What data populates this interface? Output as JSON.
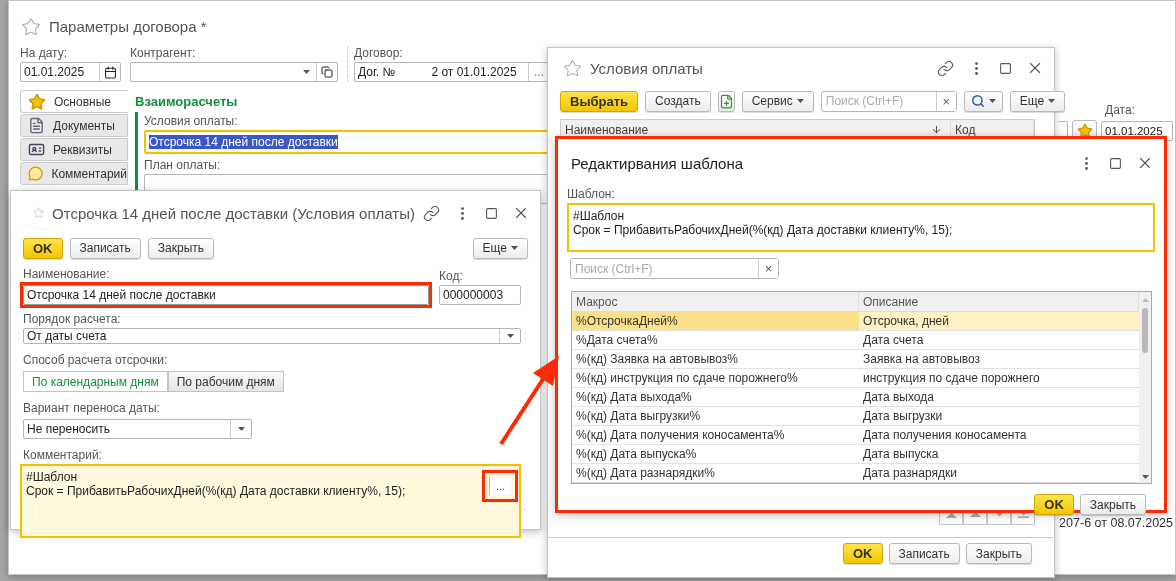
{
  "main_window": {
    "title": "Параметры договора *",
    "date_label": "На дату:",
    "date_value": "01.01.2025",
    "counterparty_label": "Контрагент:",
    "contract_label": "Договор:",
    "contract_value_start": "Дог. №",
    "contract_value_end": "2 от 01.01.2025",
    "contract_select": "...",
    "tabs": [
      {
        "label": "Основные",
        "selected": true,
        "kind": "star"
      },
      {
        "label": "Документы",
        "selected": false,
        "kind": "document"
      },
      {
        "label": "Реквизиты",
        "selected": false,
        "kind": "card"
      },
      {
        "label": "Комментарий",
        "selected": false,
        "kind": "comment"
      }
    ],
    "section_title": "Взаиморасчеты",
    "payment_terms_label": "Условия оплаты:",
    "payment_terms_value": "Отсрочка 14 дней после доставки",
    "payment_terms_text_selected": true,
    "payment_plan_label": "План оплаты:",
    "right_date_label": "Дата:",
    "right_date_value": "01.01.2025",
    "footer_text": "207-6 от 08.07.2025"
  },
  "list_window": {
    "title": "Условия оплаты",
    "select": "Выбрать",
    "create": "Создать",
    "service": "Сервис",
    "search_placeholder": "Поиск (Ctrl+F)",
    "search_clear": "×",
    "more": "Еще",
    "columns": [
      "Наименование",
      "Код"
    ],
    "footer_buttons": [
      {
        "label": "OK",
        "kind": "default"
      },
      {
        "label": "Записать",
        "kind": "plain"
      },
      {
        "label": "Закрыть",
        "kind": "plain"
      }
    ]
  },
  "terms_dialog": {
    "title": "Отсрочка 14 дней после доставки (Условия оплаты)",
    "buttons": [
      {
        "label": "OK",
        "kind": "default"
      },
      {
        "label": "Записать",
        "kind": "plain"
      },
      {
        "label": "Закрыть",
        "kind": "plain"
      }
    ],
    "more": "Еще",
    "name_label": "Наименование:",
    "name_value": "Отсрочка 14 дней после доставки",
    "name_highlighted": true,
    "code_label": "Код:",
    "code_value": "000000003",
    "order_label": "Порядок расчета:",
    "order_value": "От даты счета",
    "method_label": "Способ расчета отсрочки:",
    "method_options": [
      {
        "label": "По календарным дням",
        "selected": true
      },
      {
        "label": "По рабочим дням",
        "selected": false
      }
    ],
    "shift_label": "Вариант переноса даты:",
    "shift_value": "Не переносить",
    "comment_label": "Комментарий:",
    "comment_lines": [
      "#Шаблон",
      "Срок = ПрибавитьРабочихДней(%(кд) Дата доставки клиенту%, 15);"
    ],
    "comment_button": "...",
    "comment_button_highlighted": true
  },
  "template_dialog": {
    "title": "Редактирвания шаблона",
    "highlighted": true,
    "template_label": "Шаблон:",
    "template_lines": [
      "#Шаблон",
      "Срок = ПрибавитьРабочихДней(%(кд) Дата доставки клиенту%, 15);"
    ],
    "search_placeholder": "Поиск (Ctrl+F)",
    "search_clear": "×",
    "columns": [
      "Макрос",
      "Описание"
    ],
    "macros": [
      {
        "macro": "%ОтсрочкаДней%",
        "description": "Отсрочка, дней",
        "selected": true
      },
      {
        "macro": "%Дата счета%",
        "description": "Дата счета",
        "selected": false
      },
      {
        "macro": "%(кд) Заявка на автовывоз%",
        "description": "Заявка на автовывоз",
        "selected": false
      },
      {
        "macro": "%(кд) инструкция по сдаче порожнего%",
        "description": "инструкция по сдаче порожнего",
        "selected": false
      },
      {
        "macro": "%(кд) Дата выхода%",
        "description": "Дата выхода",
        "selected": false
      },
      {
        "macro": "%(кд) Дата выгрузки%",
        "description": "Дата выгрузки",
        "selected": false
      },
      {
        "macro": "%(кд) Дата получения коносамента%",
        "description": "Дата получения коносамента",
        "selected": false
      },
      {
        "macro": "%(кд) Дата выпуска%",
        "description": "Дата выпуска",
        "selected": false
      },
      {
        "macro": "%(кд) Дата разнарядки%",
        "description": "Дата разнарядки",
        "selected": false
      }
    ],
    "buttons": [
      {
        "label": "OK",
        "kind": "default"
      },
      {
        "label": "Закрыть",
        "kind": "plain"
      }
    ]
  }
}
